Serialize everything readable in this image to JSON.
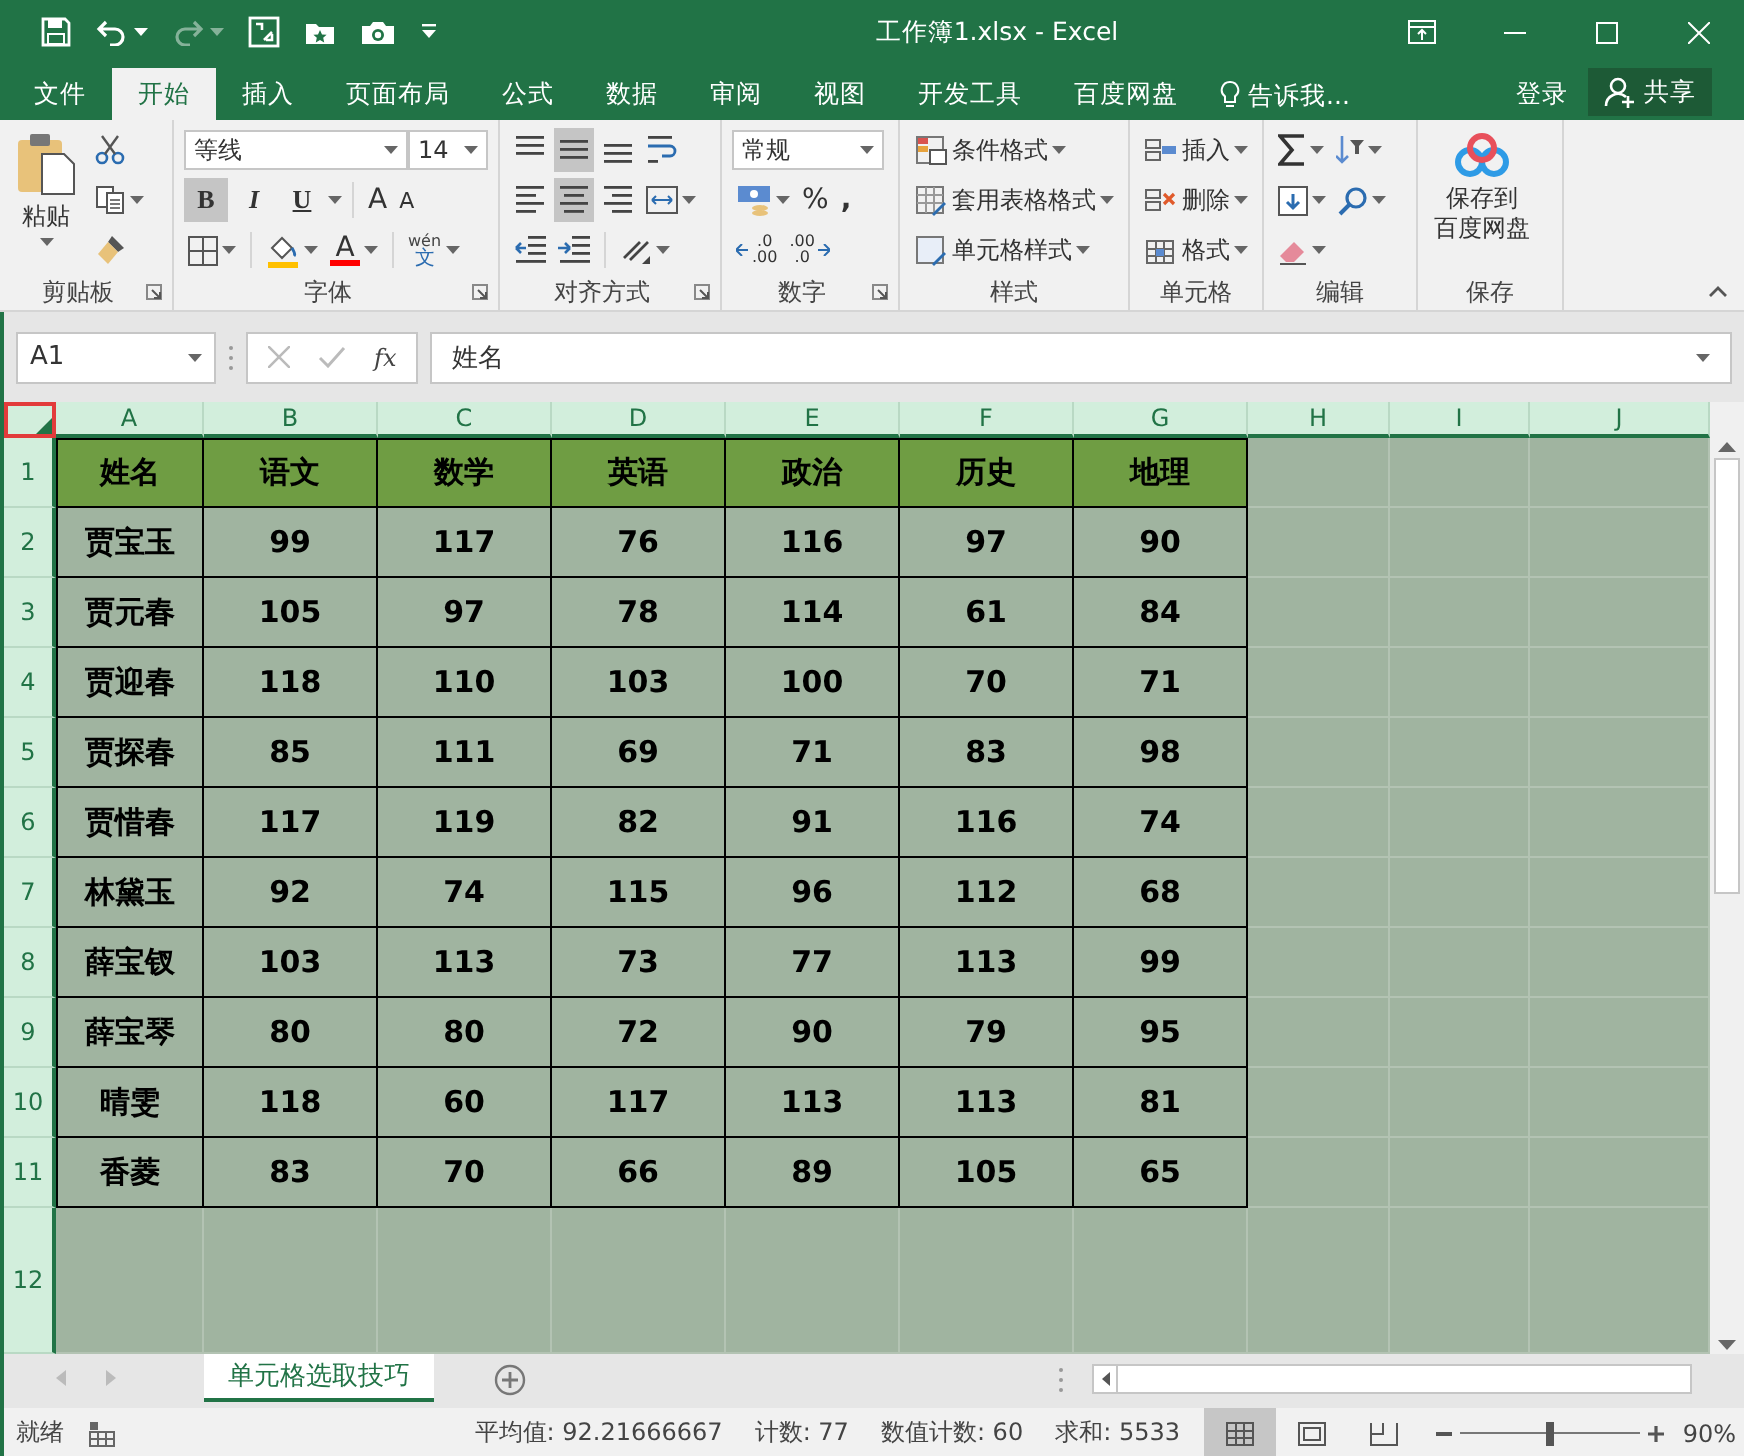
{
  "window": {
    "title": "工作簿1.xlsx - Excel"
  },
  "ribbon_tabs": [
    {
      "label": "文件",
      "selected": false
    },
    {
      "label": "开始",
      "selected": true
    },
    {
      "label": "插入",
      "selected": false
    },
    {
      "label": "页面布局",
      "selected": false
    },
    {
      "label": "公式",
      "selected": false
    },
    {
      "label": "数据",
      "selected": false
    },
    {
      "label": "审阅",
      "selected": false
    },
    {
      "label": "视图",
      "selected": false
    },
    {
      "label": "开发工具",
      "selected": false
    },
    {
      "label": "百度网盘",
      "selected": false
    }
  ],
  "tell_me": {
    "placeholder": "告诉我..."
  },
  "account": {
    "sign_in": "登录",
    "share": "共享"
  },
  "ribbon": {
    "clipboard": {
      "label": "剪贴板",
      "paste": "粘贴"
    },
    "font": {
      "label": "字体",
      "font_name": "等线",
      "font_size": "14",
      "styles": [
        {
          "label": "B",
          "selected": true
        },
        {
          "label": "I",
          "selected": false
        },
        {
          "label": "U",
          "selected": false
        }
      ],
      "grow": "A",
      "shrink": "A",
      "font_color": "A",
      "phonetic": [
        "wén",
        "文"
      ]
    },
    "alignment": {
      "label": "对齐方式",
      "buttons": [
        {
          "kind": "top",
          "selected": false
        },
        {
          "kind": "middle",
          "selected": true
        },
        {
          "kind": "bottom",
          "selected": false
        },
        {
          "kind": "wrap",
          "selected": false
        },
        {
          "kind": "left",
          "selected": false
        },
        {
          "kind": "center",
          "selected": true
        },
        {
          "kind": "right",
          "selected": false
        },
        {
          "kind": "merge",
          "selected": false
        },
        {
          "kind": "outdent",
          "selected": false
        },
        {
          "kind": "indent",
          "selected": false
        },
        {
          "kind": "orientation",
          "selected": false
        }
      ]
    },
    "number": {
      "label": "数字",
      "format": "常规",
      "percent": "%",
      "comma": ",",
      "increase_decimal": [
        ".0",
        ".00"
      ],
      "decrease_decimal": [
        ".00",
        ".0"
      ]
    },
    "styles": {
      "label": "样式",
      "items": [
        "条件格式",
        "套用表格格式",
        "单元格样式"
      ]
    },
    "cells": {
      "label": "单元格",
      "items": [
        "插入",
        "删除",
        "格式"
      ]
    },
    "editing": {
      "label": "编辑"
    },
    "save": {
      "label": "保存",
      "button": [
        "保存到",
        "百度网盘"
      ]
    }
  },
  "formula_bar": {
    "name_box": "A1",
    "function_label": "fx",
    "formula": "姓名"
  },
  "sheet": {
    "all_selected": true,
    "select_all_highlighted": true,
    "columns": [
      "A",
      "B",
      "C",
      "D",
      "E",
      "F",
      "G",
      "H",
      "I",
      "J"
    ],
    "rows": [
      "1",
      "2",
      "3",
      "4",
      "5",
      "6",
      "7",
      "8",
      "9",
      "10",
      "11",
      "12"
    ],
    "cells": [
      [
        "姓名",
        "语文",
        "数学",
        "英语",
        "政治",
        "历史",
        "地理"
      ],
      [
        "贾宝玉",
        "99",
        "117",
        "76",
        "116",
        "97",
        "90"
      ],
      [
        "贾元春",
        "105",
        "97",
        "78",
        "114",
        "61",
        "84"
      ],
      [
        "贾迎春",
        "118",
        "110",
        "103",
        "100",
        "70",
        "71"
      ],
      [
        "贾探春",
        "85",
        "111",
        "69",
        "71",
        "83",
        "98"
      ],
      [
        "贾惜春",
        "117",
        "119",
        "82",
        "91",
        "116",
        "74"
      ],
      [
        "林黛玉",
        "92",
        "74",
        "115",
        "96",
        "112",
        "68"
      ],
      [
        "薛宝钗",
        "103",
        "113",
        "73",
        "77",
        "113",
        "99"
      ],
      [
        "薛宝琴",
        "80",
        "80",
        "72",
        "90",
        "79",
        "95"
      ],
      [
        "晴雯",
        "118",
        "60",
        "117",
        "113",
        "113",
        "81"
      ],
      [
        "香菱",
        "83",
        "70",
        "66",
        "89",
        "105",
        "65"
      ]
    ]
  },
  "sheet_tabs": [
    {
      "label": "单元格选取技巧",
      "selected": true
    }
  ],
  "status_bar": {
    "ready": "就绪",
    "stats": [
      "平均值: 92.21666667",
      "计数: 77",
      "数值计数: 60",
      "求和: 5533"
    ],
    "views": [
      {
        "kind": "normal",
        "selected": true
      },
      {
        "kind": "page_layout",
        "selected": false
      },
      {
        "kind": "page_break",
        "selected": false
      }
    ],
    "zoom": {
      "level": 0.5,
      "label": "90%"
    }
  }
}
